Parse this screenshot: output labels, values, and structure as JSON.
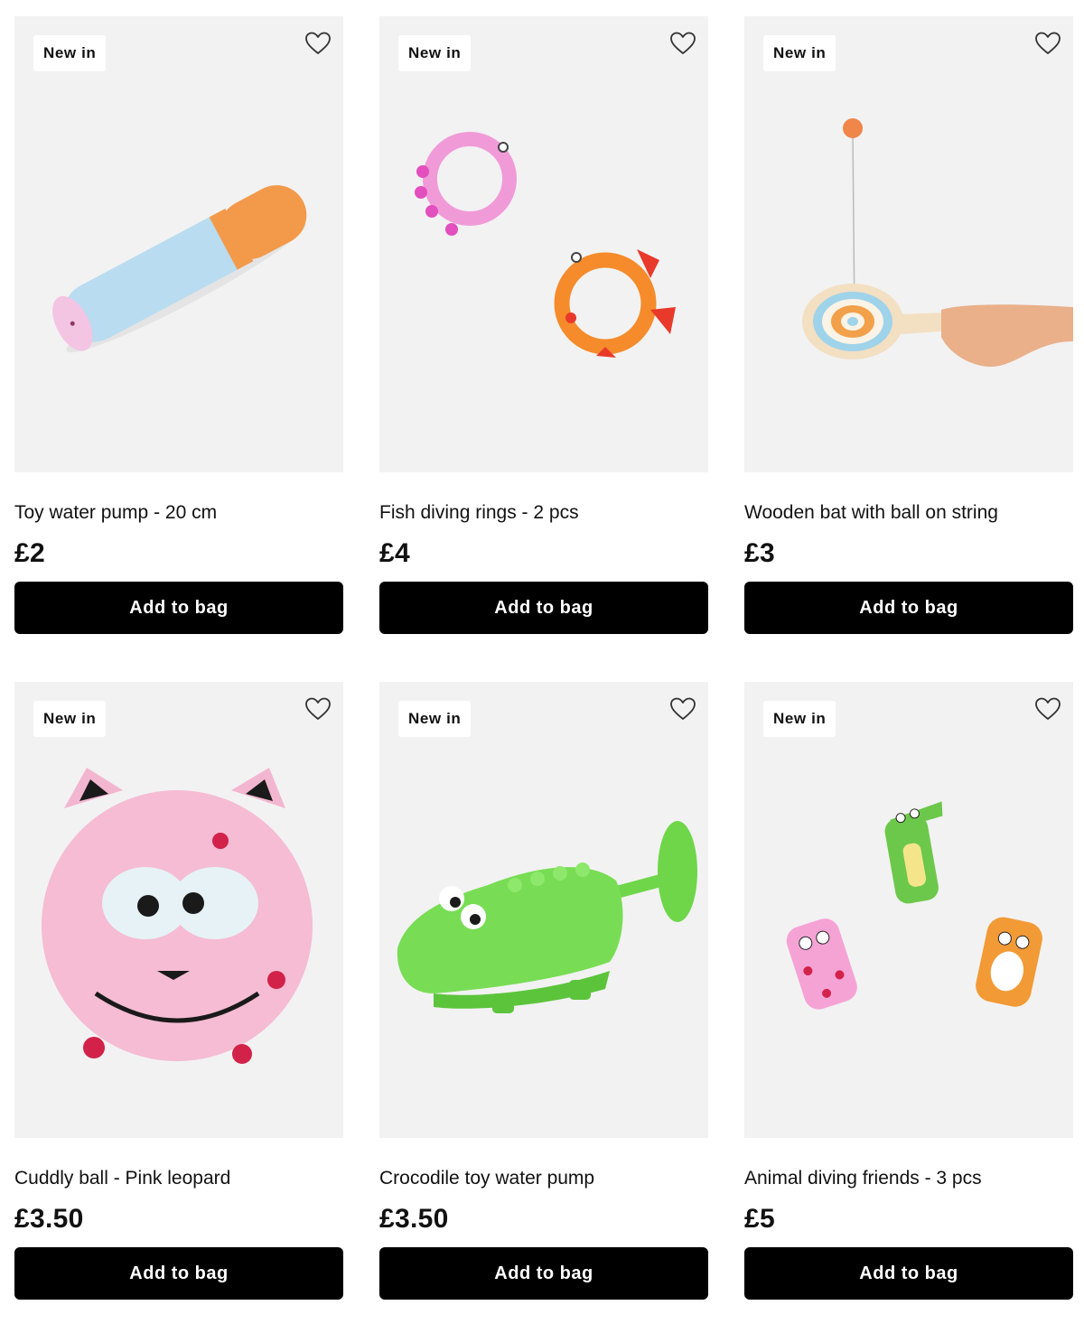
{
  "products": [
    {
      "badge": "New in",
      "title": "Toy water pump - 20 cm",
      "price": "£2",
      "button": "Add to bag",
      "image": "foam-water-pump"
    },
    {
      "badge": "New in",
      "title": "Fish diving rings - 2 pcs",
      "price": "£4",
      "button": "Add to bag",
      "image": "fish-diving-rings"
    },
    {
      "badge": "New in",
      "title": "Wooden bat with ball on string",
      "price": "£3",
      "button": "Add to bag",
      "image": "paddle-ball"
    },
    {
      "badge": "New in",
      "title": "Cuddly ball - Pink leopard",
      "price": "£3.50",
      "button": "Add to bag",
      "image": "pink-leopard-plush"
    },
    {
      "badge": "New in",
      "title": "Crocodile toy water pump",
      "price": "£3.50",
      "button": "Add to bag",
      "image": "crocodile-water-pump"
    },
    {
      "badge": "New in",
      "title": "Animal diving friends - 3 pcs",
      "price": "£5",
      "button": "Add to bag",
      "image": "animal-diving-friends"
    }
  ],
  "colors": {
    "card_bg": "#f2f2f2",
    "button_bg": "#000000",
    "button_text": "#ffffff",
    "badge_bg": "#ffffff"
  },
  "icons": {
    "favorite": "heart-outline-icon"
  }
}
